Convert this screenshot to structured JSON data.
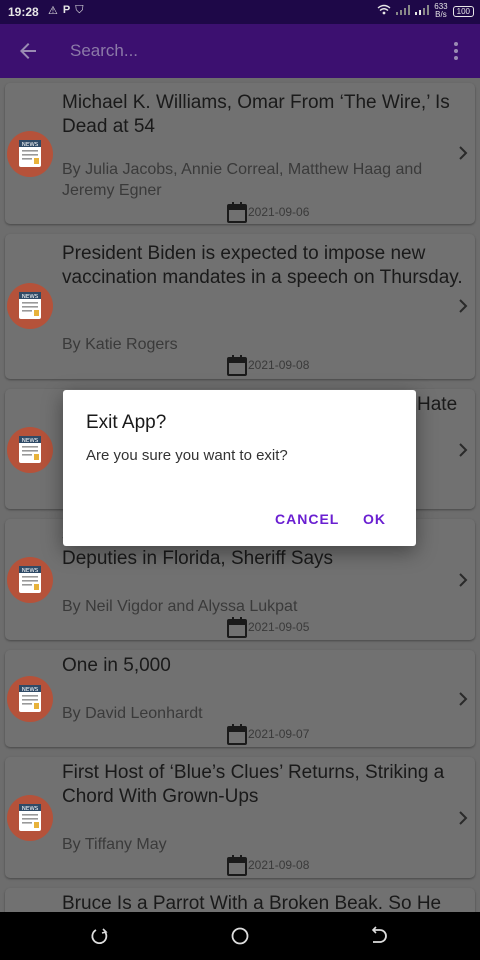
{
  "status_bar": {
    "time": "19:28",
    "net_speed_value": "633",
    "net_speed_unit": "B/s",
    "battery": "100"
  },
  "app_bar": {
    "search_placeholder": "Search..."
  },
  "articles": [
    {
      "title": "Michael K. Williams, Omar From ‘The Wire,’ Is Dead at 54",
      "author": "By Julia Jacobs, Annie Correal, Matthew Haag and Jeremy Egner",
      "date": "2021-09-06"
    },
    {
      "title": "President Biden is expected to impose new vaccination mandates in a speech on Thursday.",
      "author": "By Katie Rogers",
      "date": "2021-09-08"
    },
    {
      "title": "Hate",
      "author": "",
      "date": ""
    },
    {
      "title": "s at\nDeputies in Florida, Sheriff Says",
      "author": "By Neil Vigdor and Alyssa Lukpat",
      "date": "2021-09-05"
    },
    {
      "title": "One in 5,000",
      "author": "By David Leonhardt",
      "date": "2021-09-07"
    },
    {
      "title": "First Host of ‘Blue’s Clues’ Returns, Striking a Chord With Grown-Ups",
      "author": "By Tiffany May",
      "date": "2021-09-08"
    },
    {
      "title": "Bruce Is a Parrot With a Broken Beak. So He",
      "author": "",
      "date": ""
    }
  ],
  "news_icon_label": "NEWS",
  "dialog": {
    "title": "Exit App?",
    "message": "Are you sure you want to exit?",
    "cancel_label": "CANCEL",
    "ok_label": "OK"
  },
  "colors": {
    "app_bar": "#3c1070",
    "status_bar": "#1e0848",
    "accent": "#6a1fd1",
    "news_badge": "#b5523a"
  }
}
